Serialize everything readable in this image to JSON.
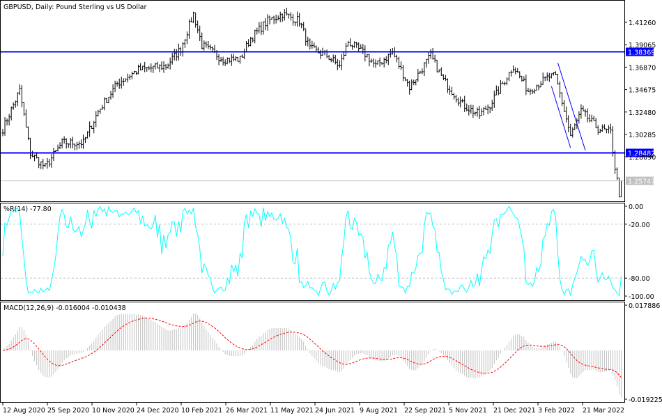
{
  "chart_data": {
    "type": "ohlc",
    "title": "GBPUSD, Daily:  Pound Sterling vs US Dollar",
    "price_axis": {
      "ticks": [
        "1.41260",
        "1.39065",
        "1.36870",
        "1.34675",
        "1.32480",
        "1.30285",
        "1.28090"
      ],
      "range": [
        1.2424,
        1.4316
      ]
    },
    "levels": [
      {
        "label": "1.38369",
        "value": 1.38369,
        "color": "#0000ff"
      },
      {
        "label": "1.28482",
        "value": 1.28482,
        "color": "#0000ff"
      },
      {
        "label": "1.25747",
        "value": 1.25747,
        "color": "#c0c0c0",
        "kind": "current"
      }
    ],
    "trend_channel": [
      [
        262,
        1.373,
        275,
        1.2872
      ],
      [
        259,
        1.35,
        268,
        1.2899
      ]
    ],
    "close_keypoints": [
      [
        0,
        1.3083
      ],
      [
        8,
        1.3458
      ],
      [
        13,
        1.2844
      ],
      [
        20,
        1.2708
      ],
      [
        28,
        1.2947
      ],
      [
        38,
        1.2947
      ],
      [
        45,
        1.3253
      ],
      [
        54,
        1.3526
      ],
      [
        64,
        1.3662
      ],
      [
        77,
        1.3697
      ],
      [
        84,
        1.3867
      ],
      [
        90,
        1.4208
      ],
      [
        94,
        1.3901
      ],
      [
        104,
        1.3765
      ],
      [
        112,
        1.3765
      ],
      [
        117,
        1.3969
      ],
      [
        125,
        1.414
      ],
      [
        132,
        1.4208
      ],
      [
        140,
        1.414
      ],
      [
        145,
        1.3867
      ],
      [
        153,
        1.3799
      ],
      [
        159,
        1.3697
      ],
      [
        163,
        1.3935
      ],
      [
        172,
        1.3799
      ],
      [
        176,
        1.3697
      ],
      [
        184,
        1.3833
      ],
      [
        192,
        1.3492
      ],
      [
        202,
        1.3799
      ],
      [
        208,
        1.356
      ],
      [
        217,
        1.3322
      ],
      [
        225,
        1.3219
      ],
      [
        230,
        1.3322
      ],
      [
        241,
        1.3697
      ],
      [
        248,
        1.3458
      ],
      [
        258,
        1.3594
      ],
      [
        261,
        1.3594
      ],
      [
        268,
        1.3015
      ],
      [
        273,
        1.3253
      ],
      [
        281,
        1.3083
      ],
      [
        287,
        1.3049
      ],
      [
        289,
        1.2708
      ],
      [
        291,
        1.2449
      ],
      [
        292,
        1.2575
      ]
    ],
    "dates": [
      "12 Aug 2020",
      "25 Sep 2020",
      "10 Nov 2020",
      "24 Dec 2020",
      "10 Feb 2021",
      "26 Mar 2021",
      "11 May 2021",
      "24 Jun 2021",
      "9 Aug 2021",
      "22 Sep 2021",
      "5 Nov 2021",
      "21 Dec 2021",
      "3 Feb 2022",
      "21 Mar 2022"
    ],
    "williams": {
      "label": "%R(14) -77.80",
      "period": 14,
      "ticks": [
        "0.00",
        "-20.00",
        "-80.00",
        "-100.00"
      ],
      "color": "#00ffff"
    },
    "macd": {
      "label": "MACD(12,26,9) -0.016004 -0.010438",
      "params": [
        12,
        26,
        9
      ],
      "ticks": [
        "0.017886",
        "-0.019225"
      ],
      "range": [
        -0.019225,
        0.017886
      ],
      "signal_color": "#ff0000",
      "hist_color": "#c0c0c0"
    }
  }
}
